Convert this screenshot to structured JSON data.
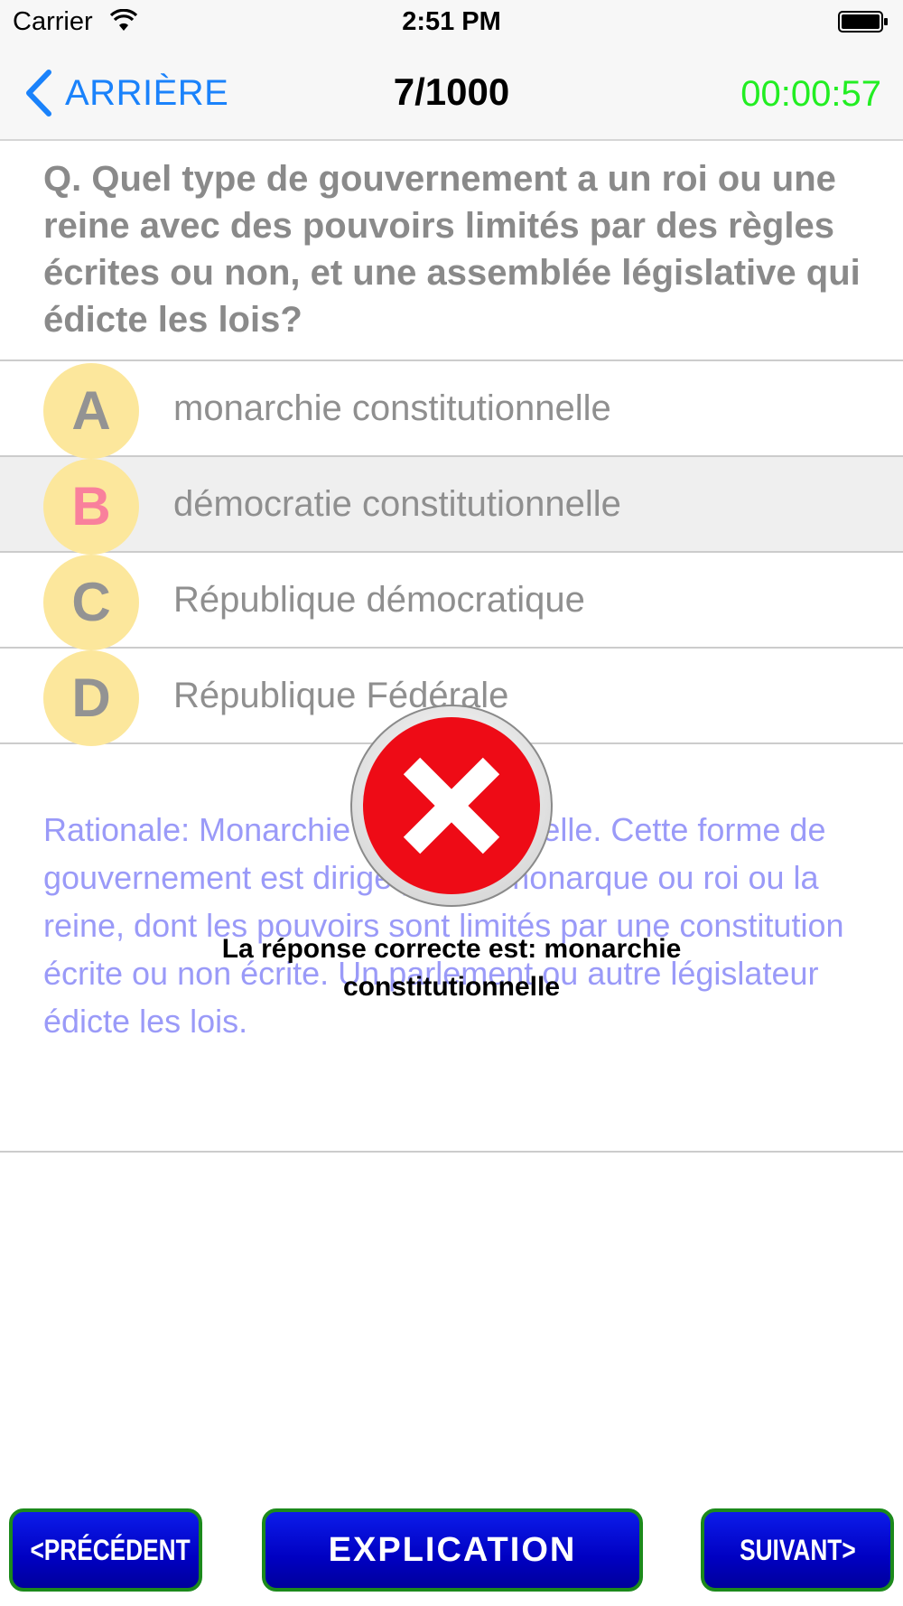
{
  "status_bar": {
    "carrier": "Carrier",
    "time": "2:51 PM",
    "wifi_icon": "wifi-icon",
    "battery_icon": "battery-icon"
  },
  "nav": {
    "back_label": "ARRIÈRE",
    "back_icon": "chevron-left-icon",
    "counter": "7/1000",
    "timer": "00:00:57",
    "timer_color": "#22ee22",
    "accent_color": "#1a82fb"
  },
  "question": {
    "text": "Q. Quel type de gouvernement a un roi ou une reine avec des pouvoirs limités par des règles écrites ou non, et une assemblée législative qui édicte les lois?"
  },
  "options": [
    {
      "letter": "A",
      "text": "monarchie constitutionnelle",
      "state": "correct"
    },
    {
      "letter": "B",
      "text": "démocratie constitutionnelle",
      "state": "selected-wrong"
    },
    {
      "letter": "C",
      "text": "République démocratique",
      "state": "normal"
    },
    {
      "letter": "D",
      "text": "République Fédérale",
      "state": "normal"
    }
  ],
  "rationale": "Rationale: Monarchie constitutionnelle. Cette forme de gouvernement est dirigé par un monarque ou roi ou la reine, dont les pouvoirs sont limités par une constitution écrite ou non écrite. Un parlement ou autre législateur édicte les lois.",
  "feedback": {
    "icon": "wrong-x-icon",
    "message": "La réponse correcte est:  monarchie constitutionnelle"
  },
  "buttons": {
    "prev": "<PRÉCÉDENT",
    "explanation": "EXPLICATION",
    "next": "SUIVANT>"
  }
}
